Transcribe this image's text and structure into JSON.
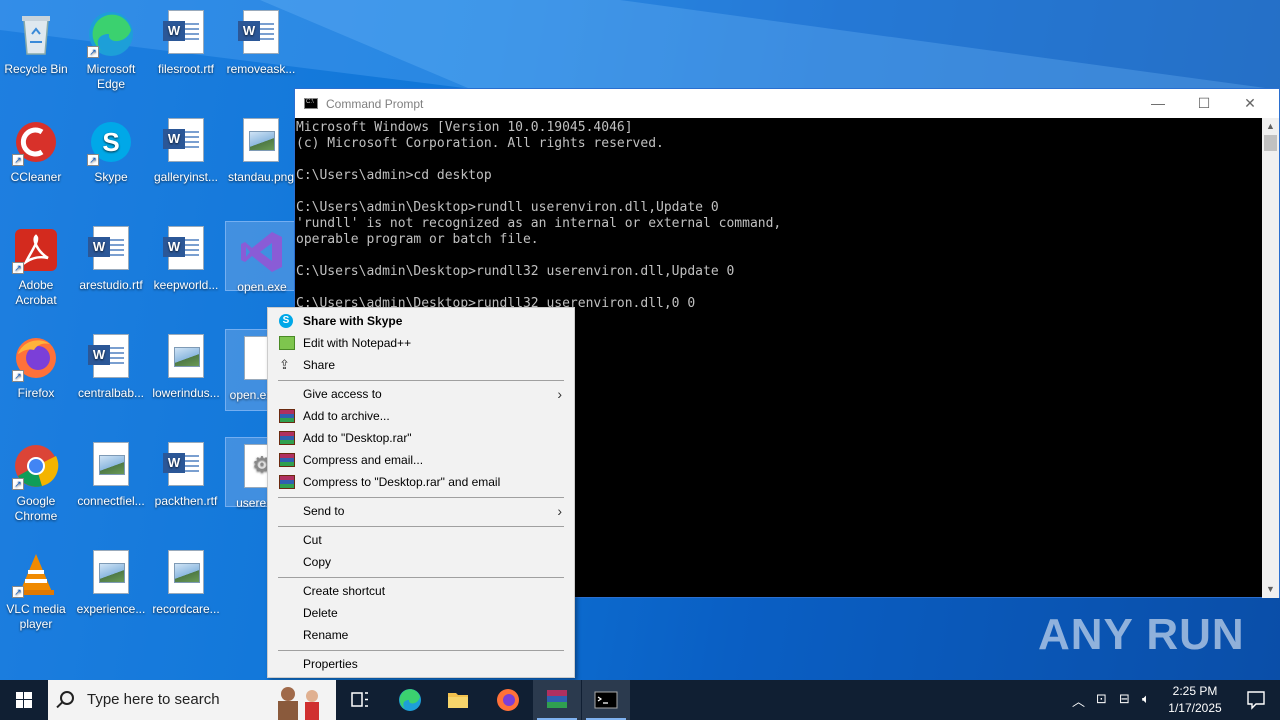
{
  "desktop": {
    "icons": [
      {
        "label": "Recycle Bin"
      },
      {
        "label": "Microsoft Edge"
      },
      {
        "label": "filesroot.rtf"
      },
      {
        "label": "removeask..."
      },
      {
        "label": "CCleaner"
      },
      {
        "label": "Skype"
      },
      {
        "label": "galleryinst..."
      },
      {
        "label": "standau.png"
      },
      {
        "label": "Adobe Acrobat"
      },
      {
        "label": "arestudio.rtf"
      },
      {
        "label": "keepworld..."
      },
      {
        "label": "open.exe"
      },
      {
        "label": "Firefox"
      },
      {
        "label": "centralbab..."
      },
      {
        "label": "lowerindus..."
      },
      {
        "label": "open.exe.fic"
      },
      {
        "label": "Google Chrome"
      },
      {
        "label": "connectfiel..."
      },
      {
        "label": "packthen.rtf"
      },
      {
        "label": "userenv..."
      },
      {
        "label": "VLC media player"
      },
      {
        "label": "experience..."
      },
      {
        "label": "recordcare..."
      }
    ]
  },
  "cmd": {
    "title": "Command Prompt",
    "minimize": "—",
    "maximize": "☐",
    "close": "✕",
    "text": "Microsoft Windows [Version 10.0.19045.4046]\n(c) Microsoft Corporation. All rights reserved.\n\nC:\\Users\\admin>cd desktop\n\nC:\\Users\\admin\\Desktop>rundll userenviron.dll,Update 0\n'rundll' is not recognized as an internal or external command,\noperable program or batch file.\n\nC:\\Users\\admin\\Desktop>rundll32 userenviron.dll,Update 0\n\nC:\\Users\\admin\\Desktop>rundll32 userenviron.dll,0 0"
  },
  "context_menu": {
    "items": [
      {
        "label": "Share with Skype"
      },
      {
        "label": "Edit with Notepad++"
      },
      {
        "label": "Share"
      },
      {
        "label": "Give access to"
      },
      {
        "label": "Add to archive..."
      },
      {
        "label": "Add to \"Desktop.rar\""
      },
      {
        "label": "Compress and email..."
      },
      {
        "label": "Compress to \"Desktop.rar\" and email"
      },
      {
        "label": "Send to"
      },
      {
        "label": "Cut"
      },
      {
        "label": "Copy"
      },
      {
        "label": "Create shortcut"
      },
      {
        "label": "Delete"
      },
      {
        "label": "Rename"
      },
      {
        "label": "Properties"
      }
    ]
  },
  "taskbar": {
    "search_placeholder": "Type here to search",
    "time": "2:25 PM",
    "date": "1/17/2025"
  },
  "watermark": "ANY RUN"
}
